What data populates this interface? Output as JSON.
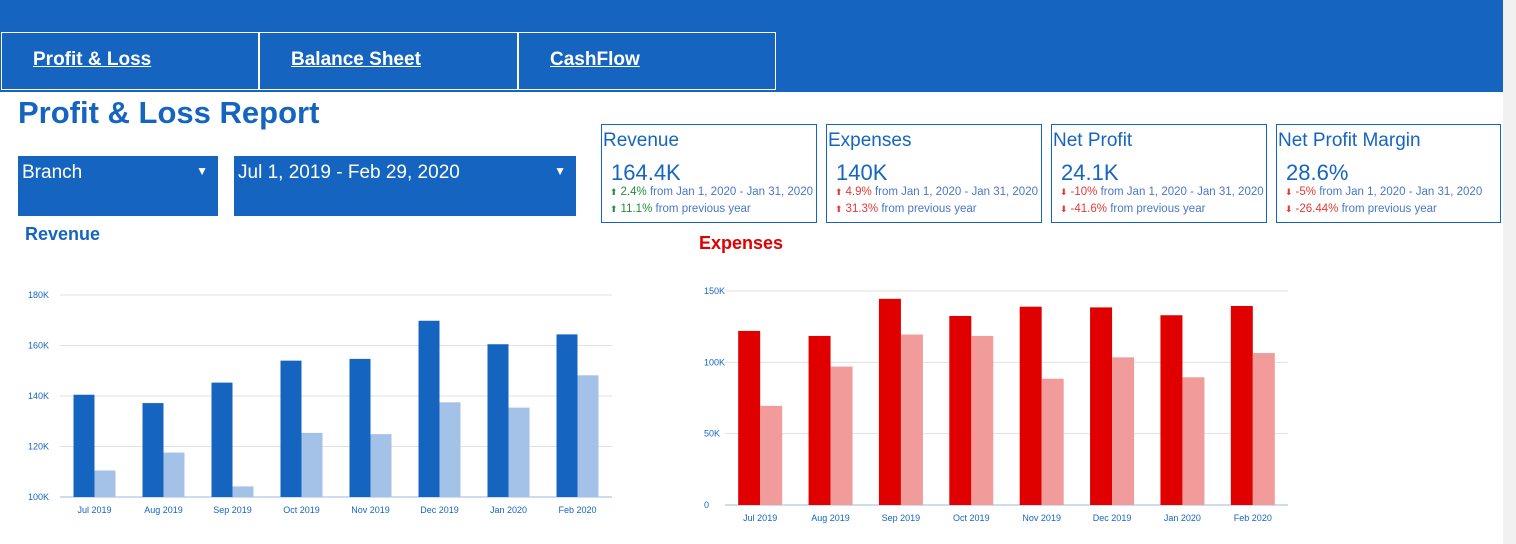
{
  "nav": {
    "tabs": [
      {
        "label": "Profit & Loss"
      },
      {
        "label": "Balance Sheet"
      },
      {
        "label": "CashFlow"
      }
    ]
  },
  "report": {
    "title": "Profit & Loss Report",
    "branch_select": {
      "value": "Branch",
      "icon": "caret-down-icon"
    },
    "date_range": {
      "value": "Jul 1, 2019 - Feb 29, 2020",
      "icon": "caret-down-icon"
    }
  },
  "kpis": [
    {
      "label": "Revenue",
      "value": "164.4K",
      "line1": {
        "delta": "2.4%",
        "text": "from Jan 1, 2020 - Jan 31, 2020",
        "direction": "up"
      },
      "line2": {
        "delta": "11.1%",
        "text": "from previous year",
        "direction": "up"
      }
    },
    {
      "label": "Expenses",
      "value": "140K",
      "line1": {
        "delta": "4.9%",
        "text": "from Jan 1, 2020 - Jan 31, 2020",
        "direction": "up-bad"
      },
      "line2": {
        "delta": "31.3%",
        "text": "from previous year",
        "direction": "up-bad"
      }
    },
    {
      "label": "Net Profit",
      "value": "24.1K",
      "line1": {
        "delta": "-10%",
        "text": "from Jan 1, 2020 - Jan 31, 2020",
        "direction": "down"
      },
      "line2": {
        "delta": "-41.6%",
        "text": "from previous year",
        "direction": "down"
      }
    },
    {
      "label": "Net Profit Margin",
      "value": "28.6%",
      "line1": {
        "delta": "-5%",
        "text": "from Jan 1, 2020 - Jan 31, 2020",
        "direction": "down"
      },
      "line2": {
        "delta": "-26.44%",
        "text": "from previous year",
        "direction": "down"
      }
    }
  ],
  "colors": {
    "brand": "#1565c0",
    "revenue_current": "#1565c0",
    "revenue_previous": "#a4c2e8",
    "expenses_current": "#e00000",
    "expenses_previous": "#f19b9b",
    "positive": "#1f8f3a",
    "negative": "#e53935"
  },
  "chart_data": [
    {
      "type": "bar",
      "title": "Revenue",
      "categories": [
        "Jul 2019",
        "Aug 2019",
        "Sep 2019",
        "Oct 2019",
        "Nov 2019",
        "Dec 2019",
        "Jan 2020",
        "Feb 2020"
      ],
      "series": [
        {
          "values": [
            140500,
            137200,
            145300,
            154000,
            154700,
            169800,
            160500,
            164400
          ]
        },
        {
          "values": [
            110500,
            117600,
            104200,
            125400,
            124900,
            137500,
            135400,
            148200
          ]
        }
      ],
      "yticks": [
        "100K",
        "120K",
        "140K",
        "160K",
        "180K"
      ],
      "ylim": [
        100000,
        180000
      ],
      "grid": true
    },
    {
      "type": "bar",
      "title": "Expenses",
      "categories": [
        "Jul 2019",
        "Aug 2019",
        "Sep 2019",
        "Oct 2019",
        "Nov 2019",
        "Dec 2019",
        "Jan 2020",
        "Feb 2020"
      ],
      "series": [
        {
          "values": [
            122000,
            118500,
            144500,
            132500,
            139000,
            138500,
            133000,
            139500
          ]
        },
        {
          "values": [
            69500,
            97000,
            119500,
            118500,
            88500,
            103500,
            89500,
            106500
          ]
        }
      ],
      "yticks": [
        "0",
        "50K",
        "100K",
        "150K"
      ],
      "ylim": [
        0,
        150000
      ],
      "grid": true
    }
  ]
}
